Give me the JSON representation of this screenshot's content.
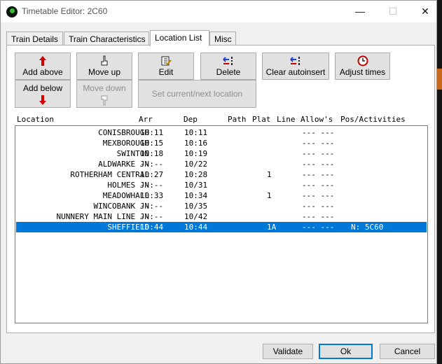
{
  "window": {
    "title": "Timetable Editor: 2C60"
  },
  "tabs": [
    {
      "label": "Train Details"
    },
    {
      "label": "Train Characteristics"
    },
    {
      "label": "Location List"
    },
    {
      "label": "Misc"
    }
  ],
  "toolbar": {
    "add_above": "Add above",
    "add_below": "Add below",
    "move_up": "Move up",
    "move_down": "Move down",
    "edit": "Edit",
    "delete": "Delete",
    "clear_autoinsert": "Clear autoinsert",
    "adjust_times": "Adjust times",
    "set_current": "Set current/next location"
  },
  "list": {
    "headers": {
      "location": "Location",
      "arr": "Arr",
      "dep": "Dep",
      "path": "Path",
      "plat": "Plat",
      "line": "Line",
      "allows": "Allow's",
      "pos": "Pos/Activities"
    },
    "rows": [
      {
        "location": "CONISBROUGH",
        "arr": "10:11",
        "dep": "10:11",
        "plat": "",
        "allow": "--- ---",
        "pos": ""
      },
      {
        "location": "MEXBOROUGH",
        "arr": "10:15",
        "dep": "10:16",
        "plat": "",
        "allow": "--- ---",
        "pos": ""
      },
      {
        "location": "SWINTON",
        "arr": "10:18",
        "dep": "10:19",
        "plat": "",
        "allow": "--- ---",
        "pos": ""
      },
      {
        "location": "ALDWARKE JN",
        "arr": "--:--",
        "dep": "10/22",
        "plat": "",
        "allow": "--- ---",
        "pos": ""
      },
      {
        "location": "ROTHERHAM CENTRAL",
        "arr": "10:27",
        "dep": "10:28",
        "plat": "1",
        "allow": "--- ---",
        "pos": ""
      },
      {
        "location": "HOLMES JN",
        "arr": "--:--",
        "dep": "10/31",
        "plat": "",
        "allow": "--- ---",
        "pos": ""
      },
      {
        "location": "MEADOWHALL",
        "arr": "10:33",
        "dep": "10:34",
        "plat": "1",
        "allow": "--- ---",
        "pos": ""
      },
      {
        "location": "WINCOBANK JN",
        "arr": "--:--",
        "dep": "10/35",
        "plat": "",
        "allow": "--- ---",
        "pos": ""
      },
      {
        "location": "NUNNERY MAIN LINE JN",
        "arr": "--:--",
        "dep": "10/42",
        "plat": "",
        "allow": "--- ---",
        "pos": ""
      },
      {
        "location": "SHEFFIELD",
        "arr": "10:44",
        "dep": "10:44",
        "plat": "1A",
        "allow": "--- ---",
        "pos": "N: 5C60"
      }
    ],
    "selected_row": 9
  },
  "footer": {
    "validate": "Validate",
    "ok": "Ok",
    "cancel": "Cancel"
  },
  "colors": {
    "selection": "#0078d7",
    "window_bg": "#f0f0f0",
    "button_bg": "#e1e1e1"
  }
}
